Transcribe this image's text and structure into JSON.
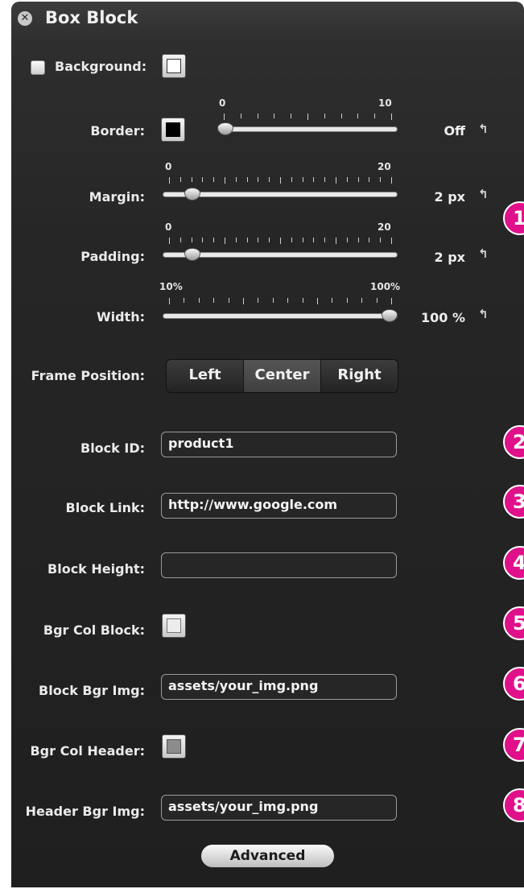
{
  "window": {
    "title": "Box Block"
  },
  "background": {
    "label": "Background:"
  },
  "sliders": [
    {
      "label": "Border:",
      "min_label": "0",
      "max_label": "10",
      "value_text": "Off",
      "fraction": 0.0
    },
    {
      "label": "Margin:",
      "min_label": "0",
      "max_label": "20",
      "value_text": "2 px",
      "fraction": 0.1
    },
    {
      "label": "Padding:",
      "min_label": "0",
      "max_label": "20",
      "value_text": "2 px",
      "fraction": 0.1
    },
    {
      "label": "Width:",
      "min_label": "10%",
      "max_label": "100%",
      "value_text": "100 %",
      "fraction": 1.0
    }
  ],
  "frame_position": {
    "label": "Frame Position:",
    "options": [
      "Left",
      "Center",
      "Right"
    ],
    "selected": "Center"
  },
  "fields": {
    "block_id": {
      "label": "Block ID:",
      "value": "product1"
    },
    "block_link": {
      "label": "Block Link:",
      "value": "http://www.google.com"
    },
    "block_height": {
      "label": "Block Height:",
      "value": ""
    },
    "bgr_col_block": {
      "label": "Bgr Col Block:"
    },
    "block_bgr_img": {
      "label": "Block Bgr Img:",
      "value": "assets/your_img.png"
    },
    "bgr_col_header": {
      "label": "Bgr Col Header:"
    },
    "header_bgr_img": {
      "label": "Header Bgr Img:",
      "value": "assets/your_img.png"
    }
  },
  "advanced_label": "Advanced",
  "badges": [
    "1",
    "2",
    "3",
    "4",
    "5",
    "6",
    "7",
    "8"
  ],
  "colors": {
    "panel": "#262626",
    "badge": "#e0108a",
    "border_swatch": "#000000",
    "bgr_col_block": "#ececec",
    "bgr_col_header": "#8c8c8c"
  }
}
